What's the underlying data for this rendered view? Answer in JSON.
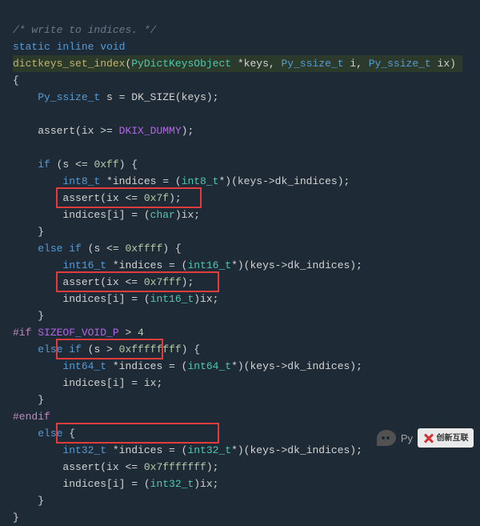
{
  "code": {
    "l0_comment": "/* write to indices. */",
    "l1_static": "static ",
    "l1_inline": "inline ",
    "l1_void": "void",
    "l2_func": "dictkeys_set_index",
    "l2_paren_open": "(",
    "l2_ty1": "PyDictKeysObject ",
    "l2_p1": "*keys, ",
    "l2_ty2": "Py_ssize_t ",
    "l2_p2": "i, ",
    "l2_ty3": "Py_ssize_t ",
    "l2_p3": "ix)",
    "l3_brace": "{",
    "l4_indent": "    ",
    "l4_ty": "Py_ssize_t ",
    "l4_rest": "s = ",
    "l4_call": "DK_SIZE",
    "l4_end": "(keys);",
    "l5_blank": " ",
    "l6_indent": "    ",
    "l6_call": "assert",
    "l6_open": "(ix >= ",
    "l6_macro": "DKIX_DUMMY",
    "l6_end": ");",
    "l7_blank": " ",
    "l8_indent": "    ",
    "l8_if": "if ",
    "l8_open": "(s <= ",
    "l8_num": "0xff",
    "l8_end": ") {",
    "l9_indent": "        ",
    "l9_ty": "int8_t ",
    "l9_rest1": "*indices = (",
    "l9_cast": "int8_t",
    "l9_rest2": "*)(keys->dk_indices);",
    "l10_indent": "        ",
    "l10_call": "assert",
    "l10_open": "(ix <= ",
    "l10_num": "0x7f",
    "l10_end": ");",
    "l11_indent": "        ",
    "l11_text": "indices[i] = (",
    "l11_cast": "char",
    "l11_end": ")ix;",
    "l12_indent": "    ",
    "l12_brace": "}",
    "l13_indent": "    ",
    "l13_else": "else if ",
    "l13_open": "(s <= ",
    "l13_num": "0xffff",
    "l13_end": ") {",
    "l14_indent": "        ",
    "l14_ty": "int16_t ",
    "l14_rest1": "*indices = (",
    "l14_cast": "int16_t",
    "l14_rest2": "*)(keys->dk_indices);",
    "l15_indent": "        ",
    "l15_call": "assert",
    "l15_open": "(ix <= ",
    "l15_num": "0x7fff",
    "l15_end": ");",
    "l16_indent": "        ",
    "l16_text": "indices[i] = (",
    "l16_cast": "int16_t",
    "l16_end": ")ix;",
    "l17_indent": "    ",
    "l17_brace": "}",
    "l18_pre": "#if ",
    "l18_macro": "SIZEOF_VOID_P",
    "l18_op": " > ",
    "l18_num": "4",
    "l19_indent": "    ",
    "l19_else": "else if ",
    "l19_open": "(s > ",
    "l19_num": "0xffffffff",
    "l19_end": ") {",
    "l20_indent": "        ",
    "l20_ty": "int64_t ",
    "l20_rest1": "*indices = (",
    "l20_cast": "int64_t",
    "l20_rest2": "*)(keys->dk_indices);",
    "l21_indent": "        ",
    "l21_text": "indices[i] = ix;",
    "l22_indent": "    ",
    "l22_brace": "}",
    "l23_pre": "#endif",
    "l24_indent": "    ",
    "l24_else": "else ",
    "l24_brace": "{",
    "l25_indent": "        ",
    "l25_ty": "int32_t ",
    "l25_rest1": "*indices = (",
    "l25_cast": "int32_t",
    "l25_rest2": "*)(keys->dk_indices);",
    "l26_indent": "        ",
    "l26_call": "assert",
    "l26_open": "(ix <= ",
    "l26_num": "0x7fffffff",
    "l26_end": ");",
    "l27_indent": "        ",
    "l27_text": "indices[i] = (",
    "l27_cast": "int32_t",
    "l27_end": ")ix;",
    "l28_indent": "    ",
    "l28_brace": "}",
    "l29_brace": "}"
  },
  "watermark": {
    "prefix": "Py",
    "brand": "创新互联"
  }
}
